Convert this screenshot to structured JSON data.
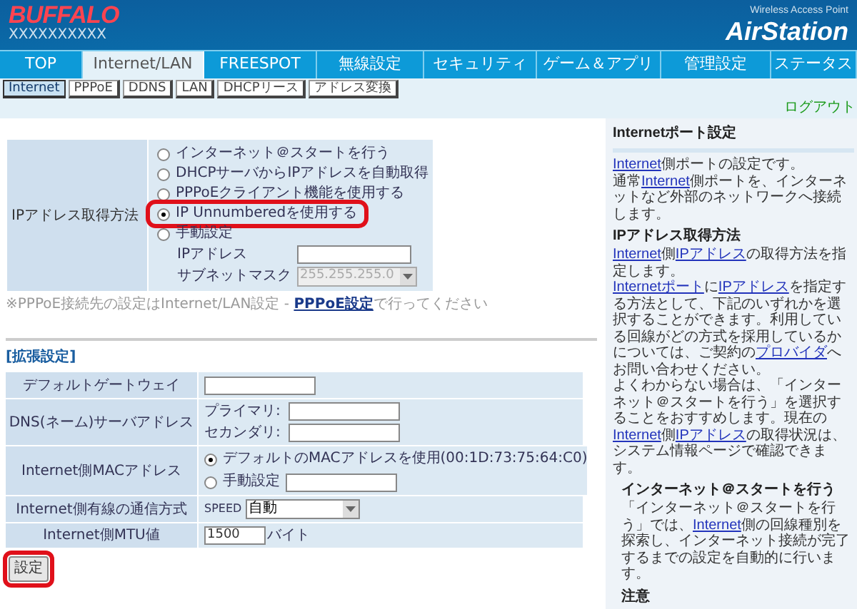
{
  "header": {
    "logo": "BUFFALO",
    "device_name": "XXXXXXXXXX",
    "product_tagline": "Wireless Access Point",
    "product_name": "AirStation"
  },
  "nav_tabs": [
    {
      "label": "TOP",
      "selected": false
    },
    {
      "label": "Internet/LAN",
      "selected": true
    },
    {
      "label": "FREESPOT",
      "selected": false
    },
    {
      "label": "無線設定",
      "selected": false
    },
    {
      "label": "セキュリティ",
      "selected": false
    },
    {
      "label": "ゲーム＆アプリ",
      "selected": false
    },
    {
      "label": "管理設定",
      "selected": false
    },
    {
      "label": "ステータス",
      "selected": false
    }
  ],
  "sub_tabs": [
    {
      "label": "Internet",
      "selected": true
    },
    {
      "label": "PPPoE",
      "selected": false
    },
    {
      "label": "DDNS",
      "selected": false
    },
    {
      "label": "LAN",
      "selected": false
    },
    {
      "label": "DHCPリース",
      "selected": false
    },
    {
      "label": "アドレス変換",
      "selected": false
    }
  ],
  "logout": "ログアウト",
  "ip_method": {
    "label": "IPアドレス取得方法",
    "options": [
      {
        "label": "インターネット＠スタートを行う",
        "selected": false,
        "highlighted": false
      },
      {
        "label": "DHCPサーバからIPアドレスを自動取得",
        "selected": false,
        "highlighted": false
      },
      {
        "label": "PPPoEクライアント機能を使用する",
        "selected": false,
        "highlighted": false
      },
      {
        "label": "IP Unnumberedを使用する",
        "selected": true,
        "highlighted": true
      },
      {
        "label": "手動設定",
        "selected": false,
        "highlighted": false
      }
    ],
    "ip_address_label": "IPアドレス",
    "subnet_label": "サブネットマスク",
    "subnet_value": "255.255.255.0",
    "subnet_disabled": true
  },
  "note": [
    {
      "text": "※PPPoE接続先の設定はInternet/LAN設定 - ",
      "link": false
    },
    {
      "text": "PPPoE設定",
      "link": true
    },
    {
      "text": "で行ってください",
      "link": false
    }
  ],
  "advanced": {
    "title": "[拡張設定]",
    "gateway_label": "デフォルトゲートウェイ",
    "dns_label": "DNS(ネーム)サーバアドレス",
    "dns_primary": "プライマリ:",
    "dns_secondary": "セカンダリ:",
    "mac_label": "Internet側MACアドレス",
    "mac_options": [
      {
        "label": "デフォルトのMACアドレスを使用(00:1D:73:75:64:C0)",
        "selected": true
      },
      {
        "label": "手動設定",
        "selected": false
      }
    ],
    "speed_label": "Internet側有線の通信方式",
    "speed_prefix": "SPEED",
    "speed_value": "自動",
    "mtu_label": "Internet側MTU値",
    "mtu_value": "1500",
    "mtu_unit": "バイト"
  },
  "submit": {
    "label": "設定",
    "highlighted": true
  },
  "help": [
    {
      "kind": "heading",
      "segments": [
        {
          "text": "Internetポート設定",
          "link": false
        }
      ]
    },
    {
      "kind": "divider"
    },
    {
      "kind": "paragraph",
      "segments": [
        {
          "text": "Internet",
          "link": true
        },
        {
          "text": "側ポートの設定です。",
          "link": false
        }
      ]
    },
    {
      "kind": "paragraph",
      "segments": [
        {
          "text": "通常",
          "link": false
        },
        {
          "text": "Internet",
          "link": true
        },
        {
          "text": "側ポートを、インターネットなど外部のネットワークへ接続します。",
          "link": false
        }
      ]
    },
    {
      "kind": "heading",
      "segments": [
        {
          "text": "IPアドレス取得方法",
          "link": false
        }
      ]
    },
    {
      "kind": "paragraph",
      "segments": [
        {
          "text": "Internet",
          "link": true
        },
        {
          "text": "側",
          "link": false
        },
        {
          "text": "IPアドレス",
          "link": true
        },
        {
          "text": "の取得方法を指定します。",
          "link": false
        }
      ]
    },
    {
      "kind": "paragraph",
      "segments": [
        {
          "text": "Internetポート",
          "link": true
        },
        {
          "text": "に",
          "link": false
        },
        {
          "text": "IPアドレス",
          "link": true
        },
        {
          "text": "を指定する方法として、下記のいずれかを選択することができます。利用している回線がどの方式を採用しているかについては、ご契約の",
          "link": false
        },
        {
          "text": "プロバイダ",
          "link": true
        },
        {
          "text": "へお問い合わせください。",
          "link": false
        }
      ]
    },
    {
      "kind": "paragraph",
      "segments": [
        {
          "text": "よくわからない場合は、「インターネット＠スタートを行う」を選択することをおすすめします。現在の",
          "link": false
        },
        {
          "text": "Internet",
          "link": true
        },
        {
          "text": "側",
          "link": false
        },
        {
          "text": "IPアドレス",
          "link": true
        },
        {
          "text": "の取得状況は、システム情報ページで確認できます。",
          "link": false
        }
      ]
    },
    {
      "kind": "subheading",
      "segments": [
        {
          "text": "インターネット＠スタートを行う",
          "link": false
        }
      ]
    },
    {
      "kind": "subparagraph",
      "segments": [
        {
          "text": "「インターネット＠スタートを行う」では、",
          "link": false
        },
        {
          "text": "Internet",
          "link": true
        },
        {
          "text": "側の回線種別を探索し、インターネット接続が完了するまでの設定を自動的に行います。",
          "link": false
        }
      ]
    },
    {
      "kind": "subheading",
      "segments": [
        {
          "text": "注意",
          "link": false
        }
      ]
    }
  ]
}
